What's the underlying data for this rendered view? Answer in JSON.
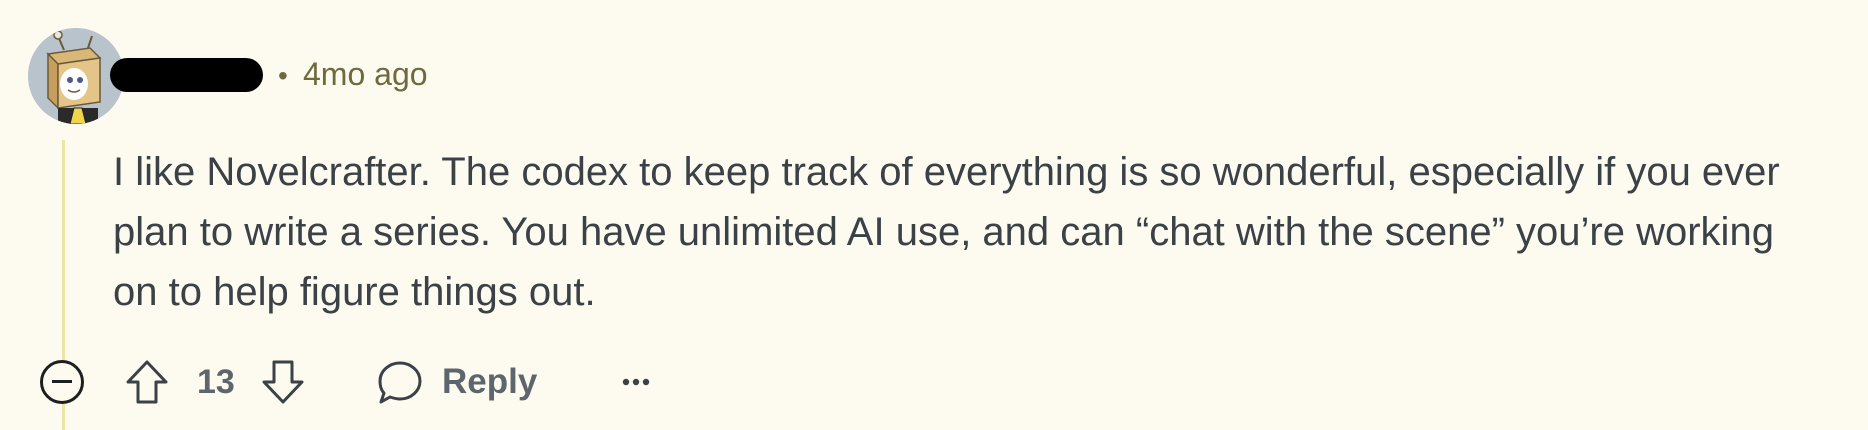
{
  "comment": {
    "avatar_icon": "robot-box-avatar-icon",
    "username_redacted": true,
    "separator": "•",
    "timestamp": "4mo ago",
    "body": "I like Novelcrafter. The codex to keep track of everything is so wonderful, especially if you ever plan to write a series. You have unlimited AI use, and can “chat with the scene” you’re working on to help figure things out."
  },
  "actions": {
    "collapse_icon": "minus-circle-icon",
    "upvote_icon": "arrow-up-icon",
    "score": "13",
    "downvote_icon": "arrow-down-icon",
    "reply_icon": "speech-bubble-icon",
    "reply_label": "Reply",
    "more_icon": "ellipsis-icon"
  },
  "colors": {
    "background": "#fdfbef",
    "text": "#3a4147",
    "meta": "#6f6a3e",
    "thread_line": "#ece6a6",
    "action_gray": "#5d666d"
  }
}
